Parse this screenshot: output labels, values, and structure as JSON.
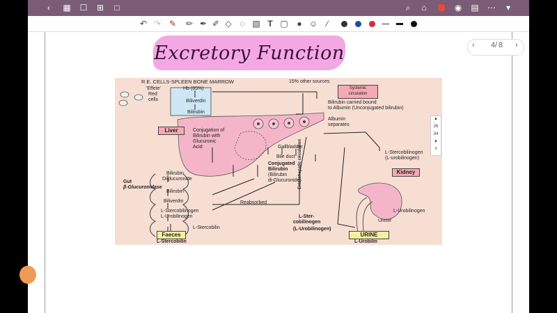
{
  "colors": {
    "topbar": "#7a5c76",
    "title_highlight": "#f3a8e4",
    "diagram_bg": "#f7ded3",
    "label_box": "#f4a9b5",
    "yellow_box": "#f5f0a0",
    "blue_box": "#cfe7f5",
    "accent_orange": "#f19a58"
  },
  "topbar": {
    "icons": [
      "back-icon",
      "grid-icon",
      "bookmark-icon",
      "export-icon",
      "view-icon",
      "search-icon",
      "shirt-icon",
      "record-icon",
      "eye-icon",
      "page-icon",
      "more-icon",
      "dropdown-icon"
    ]
  },
  "toolbar": {
    "icons": [
      "undo-icon",
      "redo-icon",
      "pen-icon",
      "pencil-icon",
      "marker-icon",
      "highlighter-icon",
      "eraser-icon",
      "lasso-icon",
      "image-icon",
      "text-icon",
      "shape-icon",
      "mic-icon",
      "sticker-icon",
      "ruler-icon"
    ],
    "color_swatches": [
      "#333333",
      "#1f4e9e",
      "#d92b3a"
    ],
    "stroke_widths": [
      "thin",
      "medium",
      "thick"
    ]
  },
  "title": "Excretory Function",
  "pager": {
    "current": "4",
    "total": "8",
    "separator": "/"
  },
  "side_scroll": {
    "values": [
      "26",
      "34"
    ]
  },
  "diagram": {
    "header": "R.E. CELLS-SPLEEN BONE MARROW",
    "other_sources": "15% other sources",
    "effete_red_cells": [
      "'Effete'",
      "Red",
      "cells"
    ],
    "hb": "Hb (85%)",
    "biliverdin": "Biliverdin",
    "bilirubin": "Bilirubin",
    "systemic": [
      "Systemic",
      "circulation"
    ],
    "bilirubin_carried": [
      "Bilirubin carried bound",
      "to Albumin (Unconjugated bilirubin)"
    ],
    "liver": "Liver",
    "albumin_separates": [
      "Albumin",
      "separates"
    ],
    "conjugation": [
      "Conjugation of",
      "Bilirubin with",
      "Glucuronic",
      "Acid"
    ],
    "gallbladder": "Gallbladder",
    "bile_duct": "Bile duct",
    "conjugated": [
      "Conjugated",
      "Bilirubin",
      "(Bilirubin",
      "di-Glucuronide)"
    ],
    "gut_bilirubin": [
      "Bilirubin",
      "Diglucuronide"
    ],
    "gut_label": [
      "Gut",
      "β-Glucuronidase"
    ],
    "gut_bilirubin2": "Bilirubin",
    "gut_biliverdin": "Biliverdin",
    "gut_stercobilinogen": [
      "L-Stercobilinogen",
      "L-Urobilinogen"
    ],
    "l_stercobilin": "L-Stercobilin",
    "reabsorbed": "Reabsorbed",
    "enterohepatic": "Enterohepatic circulation",
    "l_sterco_right": [
      "L-Stercobilinogen",
      "(L-urobilinogen)"
    ],
    "kidney": "Kidney",
    "l_urobilinogen": "L-Urobilinogen",
    "ureter": "Ureter",
    "l_sterc_bottom": [
      "L-Ster-",
      "cobilinogen"
    ],
    "l_urob_paren": "(L-Urobilinogen)",
    "faeces": "Faeces",
    "l_stercobilin_bottom": "L-Stercobilin",
    "urine": "URINE",
    "l_urobilin": "L-Urobilin"
  }
}
